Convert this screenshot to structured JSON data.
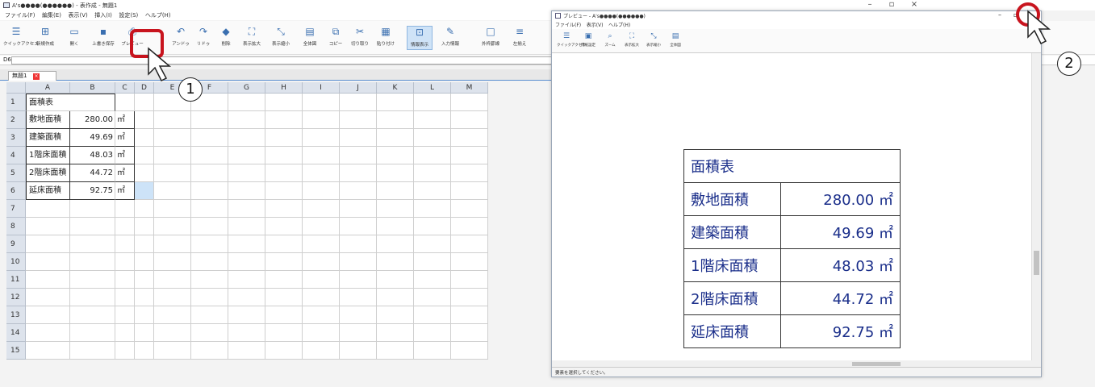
{
  "main": {
    "title": "A's●●●●(●●●●●●) - 表作成 - 無題1",
    "menu": [
      "ファイル(F)",
      "編集(E)",
      "表示(V)",
      "挿入(I)",
      "設定(S)",
      "ヘルプ(H)"
    ],
    "toolbar": [
      {
        "label": "クイックアクセス",
        "icon": "menu-icon"
      },
      {
        "label": "新規作成",
        "icon": "new-icon"
      },
      {
        "label": "開く",
        "icon": "open-icon"
      },
      {
        "label": "上書き保存",
        "icon": "save-icon"
      },
      {
        "label": "プレビュー",
        "icon": "preview-icon"
      },
      {
        "label": "アンドゥ",
        "icon": "undo-icon"
      },
      {
        "label": "リドゥ",
        "icon": "redo-icon"
      },
      {
        "label": "削除",
        "icon": "delete-icon"
      },
      {
        "label": "表示拡大",
        "icon": "zoom-in-icon"
      },
      {
        "label": "表示縮小",
        "icon": "zoom-out-icon"
      },
      {
        "label": "全体図",
        "icon": "fit-icon"
      },
      {
        "label": "コピー",
        "icon": "copy-icon"
      },
      {
        "label": "切り取り",
        "icon": "cut-icon"
      },
      {
        "label": "貼り付け",
        "icon": "paste-icon"
      },
      {
        "label": "情報表示",
        "icon": "info-icon"
      },
      {
        "label": "入力情報",
        "icon": "input-info-icon"
      },
      {
        "label": "外枠罫線",
        "icon": "border-icon"
      },
      {
        "label": "左揃え",
        "icon": "align-left-icon"
      }
    ],
    "cell_ref": "D6",
    "sheet_tab": "無題1",
    "columns": [
      "A",
      "B",
      "C",
      "D",
      "E",
      "F",
      "G",
      "H",
      "I",
      "J",
      "K",
      "L",
      "M"
    ],
    "rows": [
      "1",
      "2",
      "3",
      "4",
      "5",
      "6",
      "7",
      "8",
      "9",
      "10",
      "11",
      "12",
      "13",
      "14",
      "15"
    ],
    "cells": {
      "title": "面積表",
      "entries": [
        {
          "label": "敷地面積",
          "value": "280.00",
          "unit": "㎡"
        },
        {
          "label": "建築面積",
          "value": "49.69",
          "unit": "㎡"
        },
        {
          "label": "1階床面積",
          "value": "48.03",
          "unit": "㎡"
        },
        {
          "label": "2階床面積",
          "value": "44.72",
          "unit": "㎡"
        },
        {
          "label": "延床面積",
          "value": "92.75",
          "unit": "㎡"
        }
      ]
    }
  },
  "preview": {
    "title": "プレビュー - A's●●●●(●●●●●●)",
    "menu": [
      "ファイル(F)",
      "表示(V)",
      "ヘルプ(H)"
    ],
    "toolbar": [
      {
        "label": "クイックアクセス",
        "icon": "menu-icon"
      },
      {
        "label": "用紙設定",
        "icon": "page-setup-icon"
      },
      {
        "label": "ズーム",
        "icon": "zoom-icon"
      },
      {
        "label": "表示拡大",
        "icon": "zoom-in-icon"
      },
      {
        "label": "表示縮小",
        "icon": "zoom-out-icon"
      },
      {
        "label": "全体図",
        "icon": "fit-icon"
      }
    ],
    "table": {
      "title": "面積表",
      "rows": [
        {
          "label": "敷地面積",
          "value": "280.00 ㎡"
        },
        {
          "label": "建築面積",
          "value": "49.69 ㎡"
        },
        {
          "label": "1階床面積",
          "value": "48.03 ㎡"
        },
        {
          "label": "2階床面積",
          "value": "44.72 ㎡"
        },
        {
          "label": "延床面積",
          "value": "92.75 ㎡"
        }
      ]
    },
    "status": "要素を選択してください。"
  },
  "callouts": {
    "one": "1",
    "two": "2"
  },
  "colors": {
    "accent_ring": "#c8141e",
    "table_text": "#1a2e8a",
    "selection": "#cde3f8"
  }
}
